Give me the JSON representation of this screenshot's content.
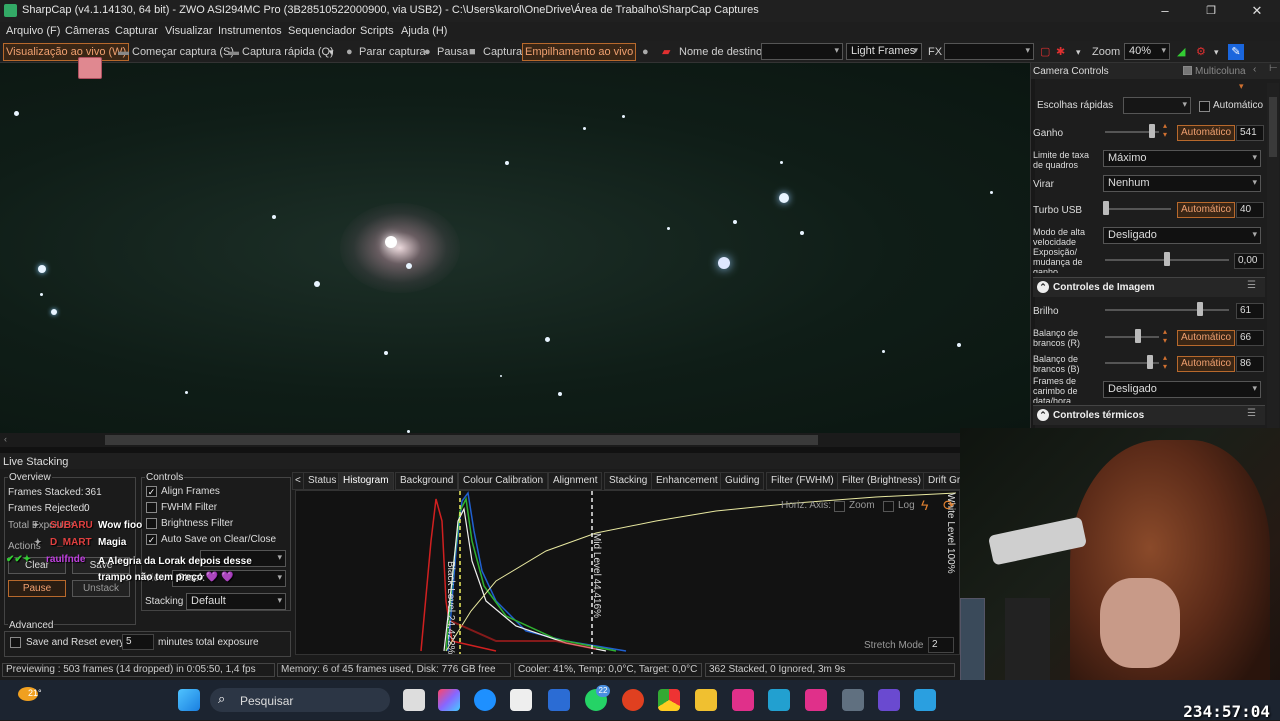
{
  "window": {
    "title": "SharpCap (v4.1.14130, 64 bit) - ZWO ASI294MC Pro (3B28510522000900, via USB2) - C:\\Users\\karol\\OneDrive\\Área de Trabalho\\SharpCap Captures"
  },
  "menu": [
    "Arquivo (F)",
    "Câmeras",
    "Capturar",
    "Visualizar",
    "Instrumentos",
    "Sequenciador",
    "Scripts",
    "Ajuda (H)"
  ],
  "toolbar": {
    "live_view": "Visualização ao vivo (W)",
    "start_capture": "Começar captura (S)",
    "quick_capture": "Captura rápida (Q)",
    "stop_capture": "Parar captura",
    "pause": "Pausa",
    "capture": "Captura",
    "live_stack": "Empilhamento ao vivo",
    "target_name": "Nome de destino",
    "frame_type": "Light Frames",
    "fx": "FX",
    "zoom_label": "Zoom",
    "zoom_value": "40%"
  },
  "camera_controls": {
    "title": "Camera Controls",
    "multicolumn": "Multicoluna",
    "quick_choices": "Escolhas rápidas",
    "automatic": "Automático",
    "gain": {
      "label": "Ganho",
      "auto": "Automático",
      "value": "541"
    },
    "frame_rate_limit": {
      "label": "Limite de taxa de quadros",
      "value": "Máximo"
    },
    "flip": {
      "label": "Virar",
      "value": "Nenhum"
    },
    "usb_turbo": {
      "label": "Turbo USB",
      "auto": "Automático",
      "value": "40"
    },
    "high_speed": {
      "label": "Modo de alta velocidade",
      "value": "Desligado"
    },
    "exposure": {
      "label": "Exposição/ mudança de ganho",
      "value": "0,00"
    }
  },
  "image_controls": {
    "title": "Controles de Imagem",
    "brightness": {
      "label": "Brilho",
      "value": "61"
    },
    "wb_r": {
      "label": "Balanço de brancos (R)",
      "auto": "Automático",
      "value": "66"
    },
    "wb_b": {
      "label": "Balanço de brancos (B)",
      "auto": "Automático",
      "value": "86"
    },
    "timestamp": {
      "label": "Frames de carimbo de data/hora",
      "value": "Desligado"
    }
  },
  "thermal_controls": {
    "title": "Controles térmicos"
  },
  "live_stacking": {
    "title": "Live Stacking",
    "overview_title": "Overview",
    "frames_stacked_label": "Frames Stacked:",
    "frames_stacked": "361",
    "frames_rejected_label": "Frames Rejected:",
    "frames_rejected": "0",
    "total_exposure_label": "Total Exposure",
    "actions_title": "Actions",
    "clear": "Clear",
    "save": "Save",
    "pause": "Pause",
    "unstack": "Unstack",
    "controls_title": "Controls",
    "align_frames": "Align Frames",
    "fwhm_filter": "FWHM Filter",
    "brightness_filter": "Brightness Filter",
    "auto_save": "Auto Save on Clear/Close",
    "view": "View",
    "view_value": "Stack",
    "stacking": "Stacking",
    "stacking_value": "Default",
    "advanced_title": "Advanced",
    "save_reset": "Save and Reset every",
    "save_reset_value": "5",
    "minutes_total": "minutes total exposure"
  },
  "tabs": [
    "Status",
    "Histogram",
    "Background",
    "Colour Calibration",
    "Alignment",
    "Stacking",
    "Enhancement",
    "Guiding",
    "Filter (FWHM)",
    "Filter (Brightness)",
    "Drift Gr"
  ],
  "histogram": {
    "horiz_axis": "Horiz. Axis:",
    "zoom": "Zoom",
    "log": "Log",
    "black_level": "Black Level 24,422%",
    "mid_level": "Mid Level 44,416%",
    "white_level": "White Level 100%",
    "stretch_mode": "Stretch Mode",
    "stretch_value": "2"
  },
  "status": {
    "previewing": "Previewing : 503 frames (14 dropped) in 0:05:50, 1,4 fps",
    "memory": "Memory: 6 of 45 frames used, Disk: 776 GB free",
    "cooler": "Cooler: 41%, Temp: 0,0°C, Target: 0,0°C",
    "stacked": "362 Stacked, 0 Ignored, 3m 9s"
  },
  "chat": [
    {
      "user": "SUBARU",
      "message": "Wow fioo",
      "color": "#e04040"
    },
    {
      "user": "D_MART",
      "message": "Magia",
      "color": "#e04040"
    },
    {
      "user": "raulfnde",
      "message": "A Alegria da Lorak depois desse trampo não tem preço 💜 💜",
      "color": "#c040e0"
    }
  ],
  "taskbar": {
    "temperature": "21°",
    "search": "Pesquisar",
    "badge": "22"
  },
  "stream_timer": "234:57:04"
}
